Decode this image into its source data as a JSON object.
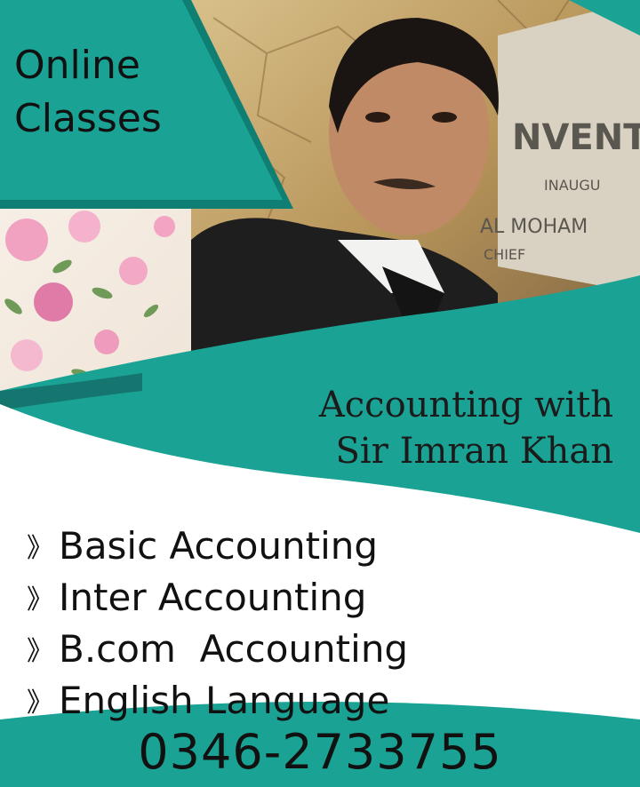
{
  "headline": {
    "line1": "Online",
    "line2": "Classes"
  },
  "title": {
    "line1": "Accounting with",
    "line2": "Sir Imran Khan"
  },
  "courses": [
    {
      "bullet": "》",
      "label": "Basic Accounting"
    },
    {
      "bullet": "》",
      "label": "Inter Accounting"
    },
    {
      "bullet": "》",
      "label": "B.com  Accounting"
    },
    {
      "bullet": "》",
      "label": "English Language"
    }
  ],
  "phone": "0346-2733755",
  "colors": {
    "teal": "#1aa394",
    "teal_dark": "#0f7f73",
    "panel_dark": "#0e4a47"
  },
  "background_sign_text": [
    "NVENT",
    "INAUGU",
    "AL MOHAM",
    "CHIEF"
  ]
}
